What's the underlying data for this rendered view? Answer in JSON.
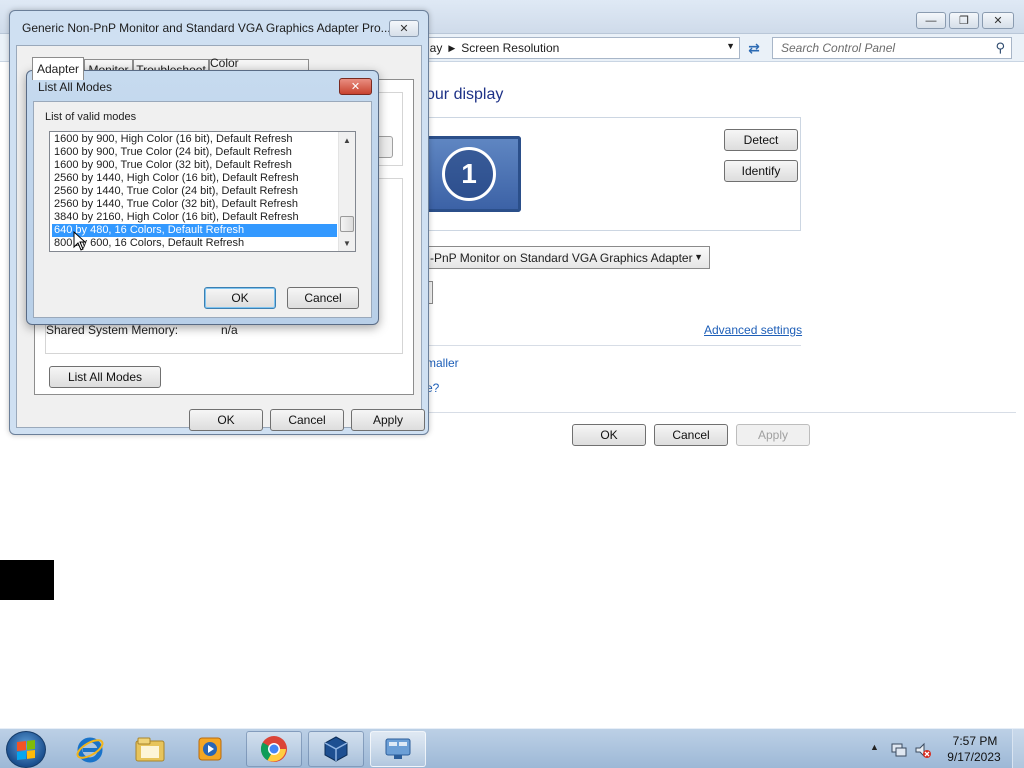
{
  "control_panel": {
    "breadcrumb": [
      "lay",
      "Screen Resolution"
    ],
    "search_placeholder": "Search Control Panel",
    "heading": "our display",
    "detect_label": "Detect",
    "identify_label": "Identify",
    "monitor_number": "1",
    "display_select": "-PnP Monitor on Standard VGA Graphics Adapter",
    "advanced_link": "Advanced settings",
    "link_smaller": "maller",
    "link_partial": "e?",
    "ok_label": "OK",
    "cancel_label": "Cancel",
    "apply_label": "Apply"
  },
  "properties_dialog": {
    "title": "Generic Non-PnP Monitor and Standard VGA Graphics Adapter Pro...",
    "close_label": "✕",
    "tabs": [
      "Adapter",
      "Monitor",
      "Troubleshoot",
      "Color Management"
    ],
    "active_tab": "Adapter",
    "shared_memory_label": "Shared System Memory:",
    "shared_memory_value": "n/a",
    "list_all_modes_label": "List All Modes",
    "ok_label": "OK",
    "cancel_label": "Cancel",
    "apply_label": "Apply"
  },
  "modes_dialog": {
    "title": "List All Modes",
    "close_label": "✕",
    "group_label": "List of valid modes",
    "modes": [
      "1600 by 900, High Color (16 bit), Default Refresh",
      "1600 by 900, True Color (24 bit), Default Refresh",
      "1600 by 900, True Color (32 bit), Default Refresh",
      "2560 by 1440, High Color (16 bit), Default Refresh",
      "2560 by 1440, True Color (24 bit), Default Refresh",
      "2560 by 1440, True Color (32 bit), Default Refresh",
      "3840 by 2160, High Color (16 bit), Default Refresh",
      "640 by 480, 16 Colors, Default Refresh",
      "800 by 600, 16 Colors, Default Refresh"
    ],
    "selected_index": 7,
    "ok_label": "OK",
    "cancel_label": "Cancel"
  },
  "taskbar": {
    "items": [
      "start-button",
      "internet-explorer-icon",
      "windows-explorer-icon",
      "media-player-icon",
      "chrome-icon",
      "virtualbox-icon",
      "control-panel-icon"
    ],
    "time": "7:57 PM",
    "date": "9/17/2023"
  },
  "colors": {
    "selection": "#3399ff",
    "link": "#1e5fb8",
    "heading": "#1e3287",
    "close_red": "#c8432f"
  }
}
